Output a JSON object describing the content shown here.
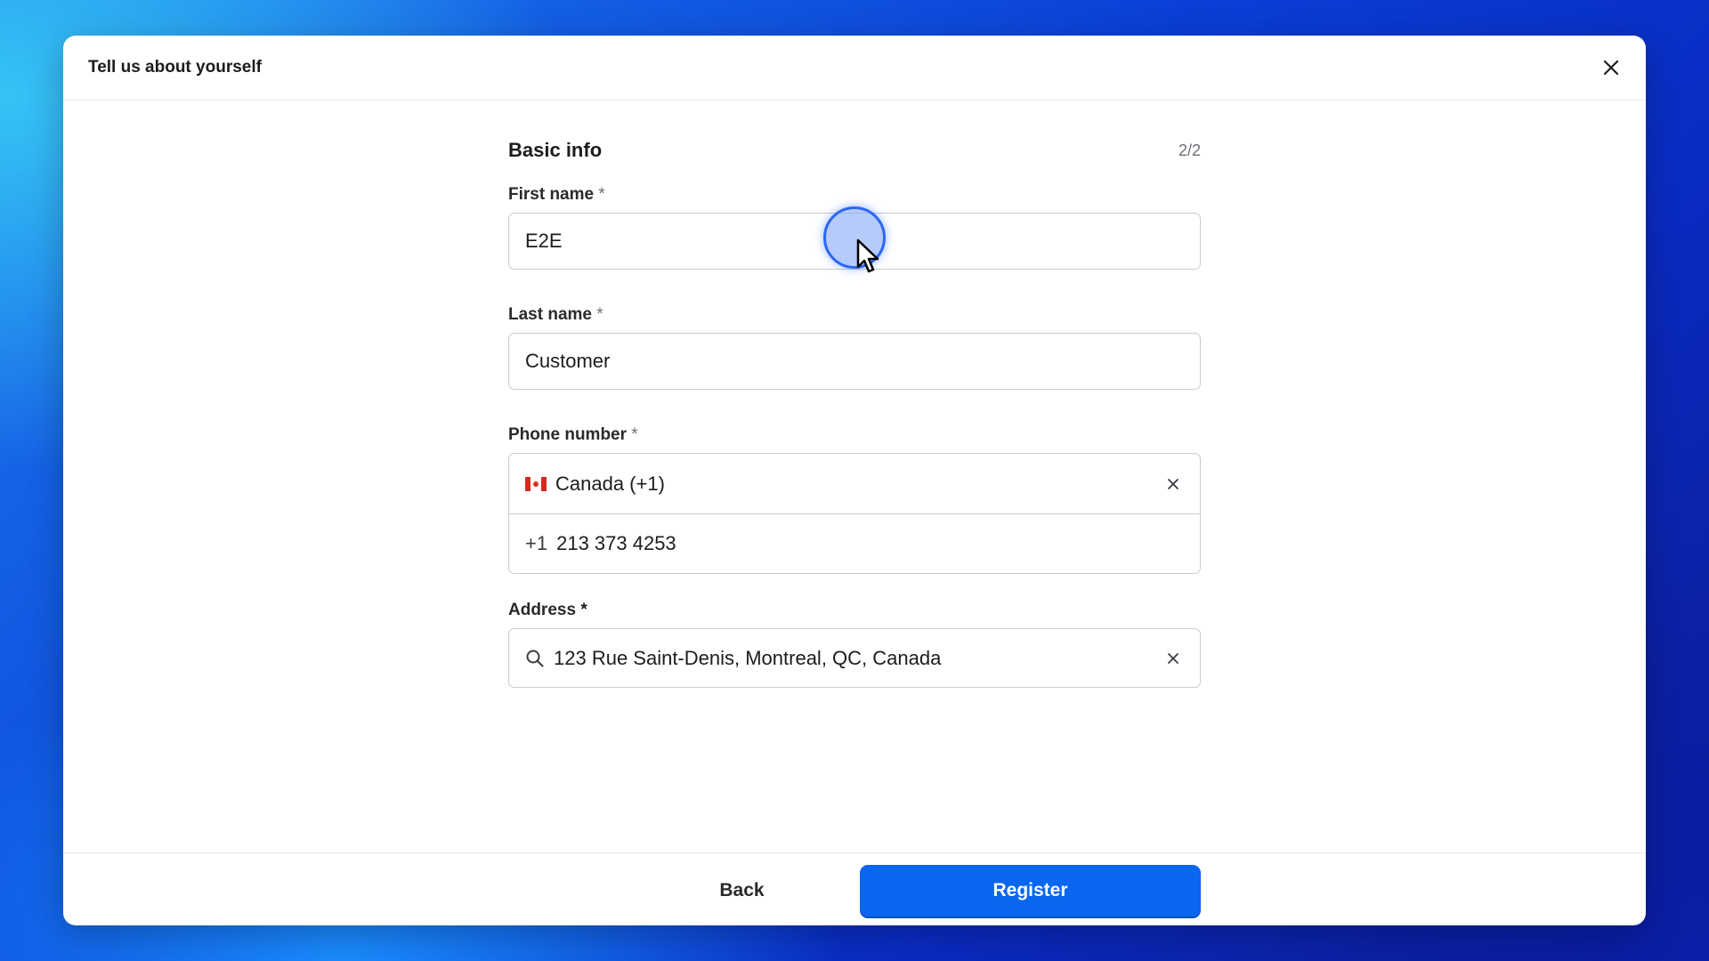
{
  "modal": {
    "title": "Tell us about yourself"
  },
  "form": {
    "section_title": "Basic info",
    "step": "2/2",
    "first_name": {
      "label": "First name",
      "required_mark": "*",
      "value": "E2E"
    },
    "last_name": {
      "label": "Last name",
      "required_mark": "*",
      "value": "Customer"
    },
    "phone": {
      "label": "Phone number",
      "required_mark": "*",
      "country": "Canada (+1)",
      "country_flag": "canada-flag-icon",
      "prefix": "+1",
      "number": "213 373 4253"
    },
    "address": {
      "label": "Address",
      "required_mark": "*",
      "value": "123 Rue Saint-Denis, Montreal, QC, Canada"
    }
  },
  "footer": {
    "back_label": "Back",
    "register_label": "Register"
  },
  "colors": {
    "primary": "#0a66ee",
    "flag_red": "#d52b1e"
  }
}
